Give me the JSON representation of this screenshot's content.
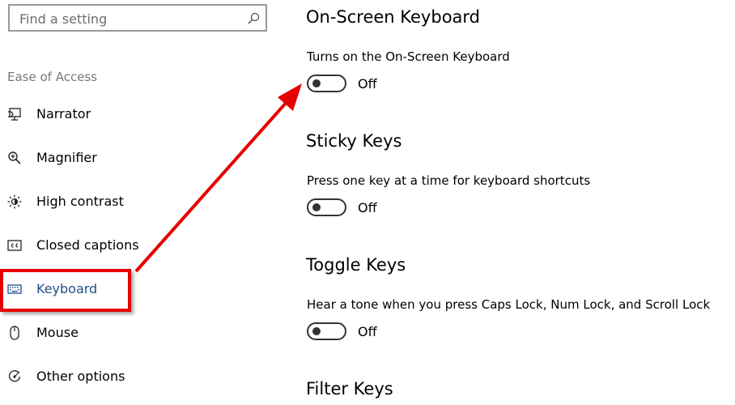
{
  "search": {
    "placeholder": "Find a setting"
  },
  "sidebar": {
    "category": "Ease of Access",
    "items": [
      {
        "label": "Narrator",
        "icon": "narrator-icon"
      },
      {
        "label": "Magnifier",
        "icon": "magnifier-icon"
      },
      {
        "label": "High contrast",
        "icon": "high-contrast-icon"
      },
      {
        "label": "Closed captions",
        "icon": "closed-captions-icon"
      },
      {
        "label": "Keyboard",
        "icon": "keyboard-icon",
        "selected": true
      },
      {
        "label": "Mouse",
        "icon": "mouse-icon"
      },
      {
        "label": "Other options",
        "icon": "other-options-icon"
      }
    ]
  },
  "main": {
    "sections": [
      {
        "title": "On-Screen Keyboard",
        "description": "Turns on the On-Screen Keyboard",
        "state": "Off"
      },
      {
        "title": "Sticky Keys",
        "description": "Press one key at a time for keyboard shortcuts",
        "state": "Off"
      },
      {
        "title": "Toggle Keys",
        "description": "Hear a tone when you press Caps Lock, Num Lock, and Scroll Lock",
        "state": "Off"
      },
      {
        "title": "Filter Keys"
      }
    ]
  },
  "colors": {
    "highlight": "#e50000",
    "selected_text": "#1f4f87",
    "accent": "#333333"
  }
}
